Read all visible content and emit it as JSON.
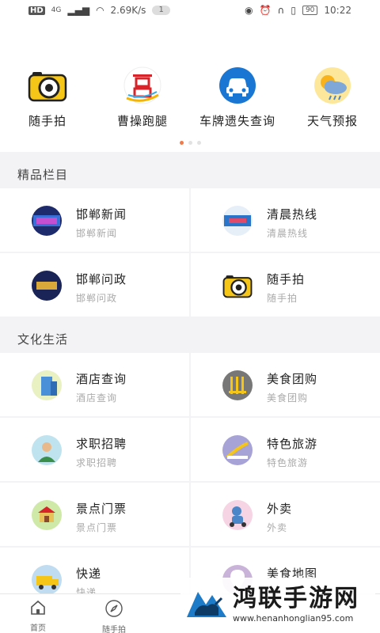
{
  "status_bar": {
    "network": "HD",
    "signal_label": "4G",
    "speed": "2.69K/s",
    "notif_count": "1",
    "battery": "90",
    "time": "10:22",
    "icons": [
      "eye-icon",
      "alarm-icon",
      "headphones-icon",
      "vibrate-icon"
    ]
  },
  "shortcuts": [
    {
      "label": "随手拍",
      "icon": "camera-icon"
    },
    {
      "label": "曹操跑腿",
      "icon": "errand-logo-icon"
    },
    {
      "label": "车牌遗失查询",
      "icon": "car-icon"
    },
    {
      "label": "天气预报",
      "icon": "weather-icon"
    }
  ],
  "sections": {
    "premium": {
      "title": "精品栏目",
      "items": [
        {
          "title": "邯郸新闻",
          "subtitle": "邯郸新闻",
          "icon": "news-icon"
        },
        {
          "title": "清晨热线",
          "subtitle": "清晨热线",
          "icon": "hotline-icon"
        },
        {
          "title": "邯郸问政",
          "subtitle": "邯郸问政",
          "icon": "politics-icon"
        },
        {
          "title": "随手拍",
          "subtitle": "随手拍",
          "icon": "camera-icon"
        }
      ]
    },
    "life": {
      "title": "文化生活",
      "items": [
        {
          "title": "酒店查询",
          "subtitle": "酒店查询",
          "icon": "hotel-icon"
        },
        {
          "title": "美食团购",
          "subtitle": "美食团购",
          "icon": "food-icon"
        },
        {
          "title": "求职招聘",
          "subtitle": "求职招聘",
          "icon": "job-icon"
        },
        {
          "title": "特色旅游",
          "subtitle": "特色旅游",
          "icon": "travel-icon"
        },
        {
          "title": "景点门票",
          "subtitle": "景点门票",
          "icon": "ticket-icon"
        },
        {
          "title": "外卖",
          "subtitle": "外卖",
          "icon": "delivery-icon"
        },
        {
          "title": "快递",
          "subtitle": "快递",
          "icon": "express-icon"
        },
        {
          "title": "美食地图",
          "subtitle": "",
          "icon": "food-map-icon"
        }
      ]
    }
  },
  "tabbar": [
    {
      "label": "首页",
      "icon": "home-icon"
    },
    {
      "label": "随手拍",
      "icon": "compass-icon"
    }
  ],
  "watermark": {
    "title": "鸿联手游网",
    "url": "www.henanhonglian95.com"
  },
  "colors": {
    "accent": "#f07a4a",
    "car_blue": "#1976d2",
    "background": "#f3f3f5"
  }
}
